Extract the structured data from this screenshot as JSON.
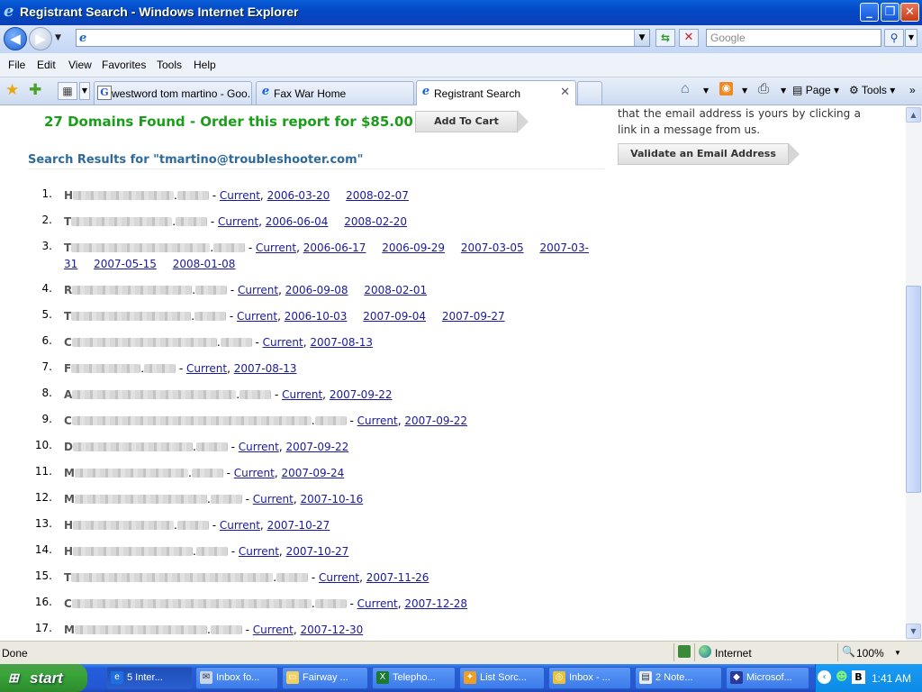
{
  "window": {
    "title": "Registrant Search - Windows Internet Explorer"
  },
  "address_bar": {
    "url": "",
    "search_placeholder": "Google"
  },
  "menu": [
    "File",
    "Edit",
    "View",
    "Favorites",
    "Tools",
    "Help"
  ],
  "tabs": [
    {
      "label": "westword tom martino - Goo...",
      "icon": "google-icon"
    },
    {
      "label": "Fax War Home",
      "icon": "ie-page-icon"
    },
    {
      "label": "Registrant Search",
      "icon": "ie-page-icon",
      "active": true
    }
  ],
  "command_bar": {
    "page": "Page",
    "tools": "Tools"
  },
  "content": {
    "promo": "27 Domains Found - Order this report for $85.00",
    "add_to_cart": "Add To Cart",
    "sidebar_text": "that the email address is yours by clicking a link in a message from us.",
    "validate_button": "Validate an Email Address",
    "results_heading": "Search Results for \"tmartino@troubleshooter.com\"",
    "results": [
      {
        "num": "1.",
        "letter": "H",
        "masked": 16,
        "tld": 5,
        "status": "Current",
        "dates": [
          "2006-03-20",
          "2008-02-07"
        ]
      },
      {
        "num": "2.",
        "letter": "T",
        "masked": 16,
        "tld": 5,
        "status": "Current",
        "dates": [
          "2006-06-04",
          "2008-02-20"
        ]
      },
      {
        "num": "3.",
        "letter": "T",
        "masked": 22,
        "tld": 5,
        "status": "Current",
        "dates": [
          "2006-06-17",
          "2006-09-29",
          "2007-03-05",
          "2007-03-31",
          "2007-05-15",
          "2008-01-08"
        ]
      },
      {
        "num": "4.",
        "letter": "R",
        "masked": 19,
        "tld": 5,
        "status": "Current",
        "dates": [
          "2006-09-08",
          "2008-02-01"
        ]
      },
      {
        "num": "5.",
        "letter": "T",
        "masked": 19,
        "tld": 5,
        "status": "Current",
        "dates": [
          "2006-10-03",
          "2007-09-04",
          "2007-09-27"
        ]
      },
      {
        "num": "6.",
        "letter": "C",
        "masked": 23,
        "tld": 5,
        "status": "Current",
        "dates": [
          "2007-08-13"
        ]
      },
      {
        "num": "7.",
        "letter": "F",
        "masked": 11,
        "tld": 5,
        "status": "Current",
        "dates": [
          "2007-08-13"
        ]
      },
      {
        "num": "8.",
        "letter": "A",
        "masked": 26,
        "tld": 5,
        "status": "Current",
        "dates": [
          "2007-09-22"
        ]
      },
      {
        "num": "9.",
        "letter": "C",
        "masked": 38,
        "tld": 5,
        "status": "Current",
        "dates": [
          "2007-09-22"
        ]
      },
      {
        "num": "10.",
        "letter": "D",
        "masked": 19,
        "tld": 5,
        "status": "Current",
        "dates": [
          "2007-09-22"
        ]
      },
      {
        "num": "11.",
        "letter": "M",
        "masked": 18,
        "tld": 5,
        "status": "Current",
        "dates": [
          "2007-09-24"
        ]
      },
      {
        "num": "12.",
        "letter": "M",
        "masked": 21,
        "tld": 5,
        "status": "Current",
        "dates": [
          "2007-10-16"
        ]
      },
      {
        "num": "13.",
        "letter": "H",
        "masked": 16,
        "tld": 5,
        "status": "Current",
        "dates": [
          "2007-10-27"
        ]
      },
      {
        "num": "14.",
        "letter": "H",
        "masked": 19,
        "tld": 5,
        "status": "Current",
        "dates": [
          "2007-10-27"
        ]
      },
      {
        "num": "15.",
        "letter": "T",
        "masked": 32,
        "tld": 5,
        "status": "Current",
        "dates": [
          "2007-11-26"
        ]
      },
      {
        "num": "16.",
        "letter": "C",
        "masked": 38,
        "tld": 5,
        "status": "Current",
        "dates": [
          "2007-12-28"
        ]
      },
      {
        "num": "17.",
        "letter": "M",
        "masked": 21,
        "tld": 5,
        "status": "Current",
        "dates": [
          "2007-12-30"
        ]
      }
    ]
  },
  "status_bar": {
    "text": "Done",
    "zone": "Internet",
    "zoom": "100%"
  },
  "taskbar": {
    "start": "start",
    "items": [
      {
        "label": "5 Inter...",
        "icon": "ie-icon",
        "active": true
      },
      {
        "label": "Inbox fo...",
        "icon": "mail-icon"
      },
      {
        "label": "Fairway ...",
        "icon": "folder-icon"
      },
      {
        "label": "Telepho...",
        "icon": "excel-icon"
      },
      {
        "label": "List Sorc...",
        "icon": "wand-icon"
      },
      {
        "label": "Inbox - ...",
        "icon": "mail-client-icon"
      },
      {
        "label": "2 Note...",
        "icon": "notepad-icon"
      },
      {
        "label": "Microsof...",
        "icon": "app-icon"
      }
    ],
    "clock": "1:41 AM"
  },
  "colors": {
    "promo_green": "#1a9e1a",
    "heading_blue": "#2e6a9c",
    "link_blue": "#1a1a9c",
    "taskbar_blue": "#245edb",
    "start_green": "#37a537"
  }
}
